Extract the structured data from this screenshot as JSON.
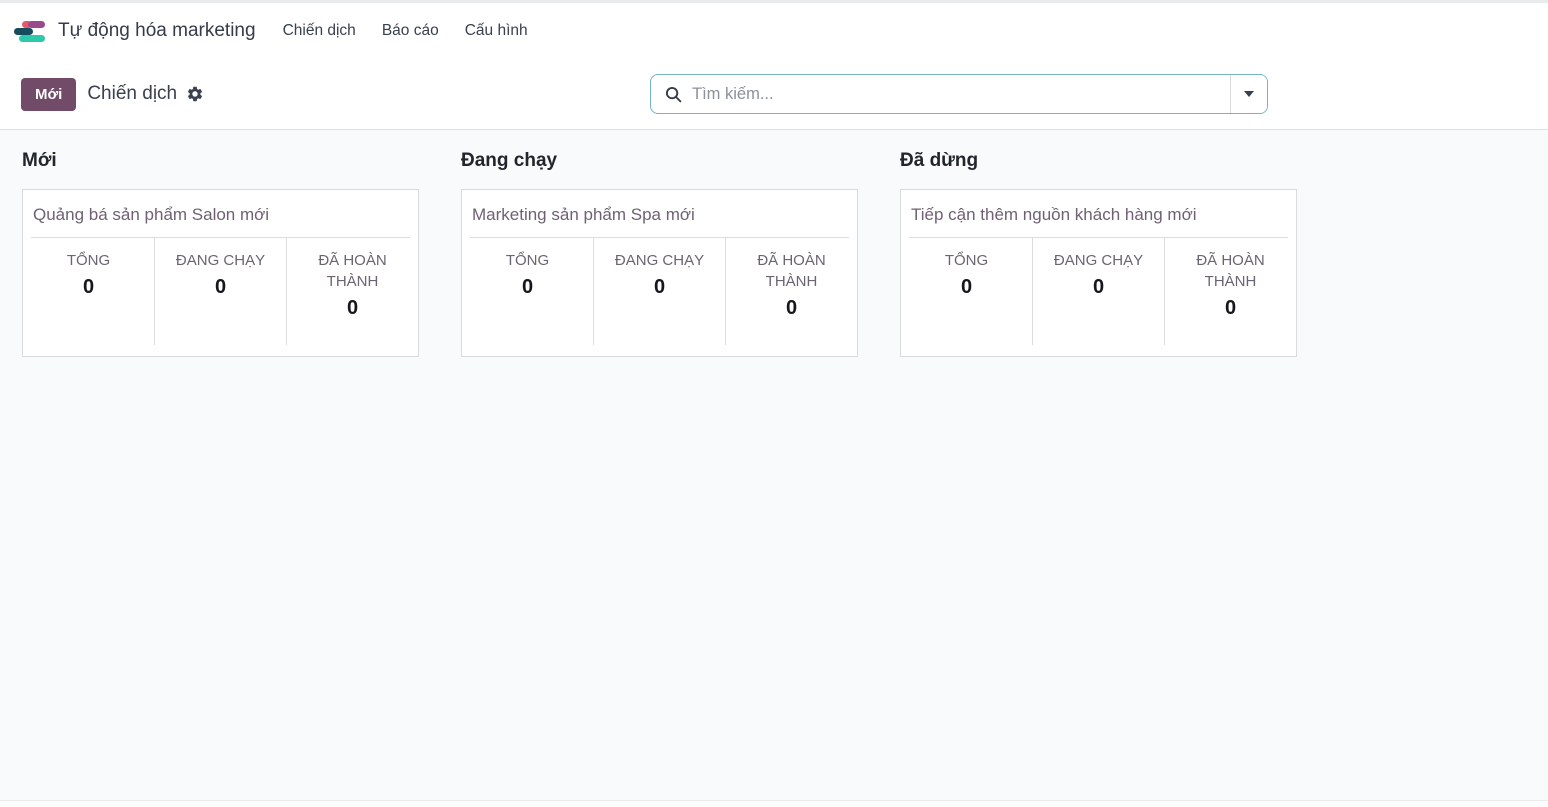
{
  "app": {
    "name": "Tự động hóa marketing",
    "logo_colors": {
      "pink": "#e7586b",
      "purple": "#9a4a8c",
      "navy": "#174b5e",
      "teal": "#2ec8ab"
    }
  },
  "nav": {
    "items": [
      {
        "label": "Chiến dịch"
      },
      {
        "label": "Báo cáo"
      },
      {
        "label": "Cấu hình"
      }
    ]
  },
  "control_panel": {
    "new_button_label": "Mới",
    "breadcrumb": "Chiến dịch",
    "accent_color": "#714B67",
    "search": {
      "placeholder": "Tìm kiếm...",
      "border_color": "#74b5c1"
    }
  },
  "kanban": {
    "columns": [
      {
        "title": "Mới",
        "cards": [
          {
            "name": "Quảng bá sản phẩm Salon mới",
            "stats": [
              {
                "label": "TỔNG",
                "value": "0"
              },
              {
                "label": "ĐANG CHẠY",
                "value": "0"
              },
              {
                "label": "ĐÃ HOÀN THÀNH",
                "value": "0"
              }
            ]
          }
        ]
      },
      {
        "title": "Đang chạy",
        "cards": [
          {
            "name": "Marketing sản phẩm Spa mới",
            "stats": [
              {
                "label": "TỔNG",
                "value": "0"
              },
              {
                "label": "ĐANG CHẠY",
                "value": "0"
              },
              {
                "label": "ĐÃ HOÀN THÀNH",
                "value": "0"
              }
            ]
          }
        ]
      },
      {
        "title": "Đã dừng",
        "cards": [
          {
            "name": "Tiếp cận thêm nguồn khách hàng mới",
            "stats": [
              {
                "label": "TỔNG",
                "value": "0"
              },
              {
                "label": "ĐANG CHẠY",
                "value": "0"
              },
              {
                "label": "ĐÃ HOÀN THÀNH",
                "value": "0"
              }
            ]
          }
        ]
      }
    ]
  }
}
